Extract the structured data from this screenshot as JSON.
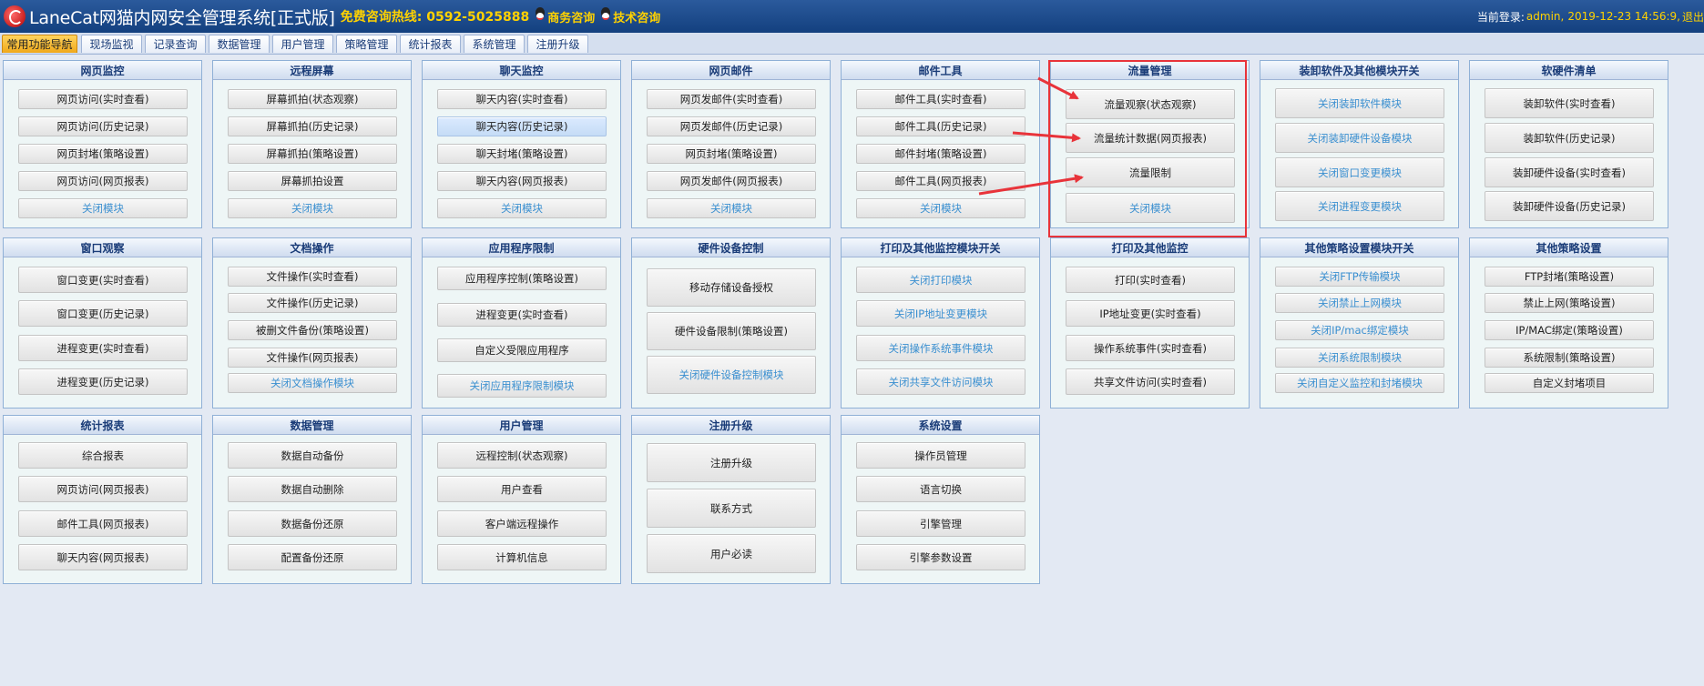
{
  "header": {
    "title": "LaneCat网猫内网安全管理系统[正式版]",
    "hotline": "免费咨询热线: 0592-5025888",
    "business_consult": "商务咨询",
    "tech_consult": "技术咨询",
    "login_label": "当前登录:",
    "login_user": "admin,",
    "login_time": "2019-12-23 14:56:9,",
    "logout": "退出"
  },
  "tabs": [
    {
      "label": "常用功能导航",
      "active": true
    },
    {
      "label": "现场监视"
    },
    {
      "label": "记录查询"
    },
    {
      "label": "数据管理"
    },
    {
      "label": "用户管理"
    },
    {
      "label": "策略管理"
    },
    {
      "label": "统计报表"
    },
    {
      "label": "系统管理"
    },
    {
      "label": "注册升级"
    }
  ],
  "panels": [
    {
      "title": "网页监控",
      "items": [
        "网页访问(实时查看)",
        "网页访问(历史记录)",
        "网页封堵(策略设置)",
        "网页访问(网页报表)",
        "关闭模块"
      ]
    },
    {
      "title": "远程屏幕",
      "items": [
        "屏幕抓拍(状态观察)",
        "屏幕抓拍(历史记录)",
        "屏幕抓拍(策略设置)",
        "屏幕抓拍设置",
        "关闭模块"
      ]
    },
    {
      "title": "聊天监控",
      "items": [
        "聊天内容(实时查看)",
        "聊天内容(历史记录)",
        "聊天封堵(策略设置)",
        "聊天内容(网页报表)",
        "关闭模块"
      ]
    },
    {
      "title": "网页邮件",
      "items": [
        "网页发邮件(实时查看)",
        "网页发邮件(历史记录)",
        "网页封堵(策略设置)",
        "网页发邮件(网页报表)",
        "关闭模块"
      ]
    },
    {
      "title": "邮件工具",
      "items": [
        "邮件工具(实时查看)",
        "邮件工具(历史记录)",
        "邮件封堵(策略设置)",
        "邮件工具(网页报表)",
        "关闭模块"
      ]
    },
    {
      "title": "流量管理",
      "items": [
        "流量观察(状态观察)",
        "流量统计数据(网页报表)",
        "流量限制",
        "关闭模块"
      ]
    },
    {
      "title": "装卸软件及其他模块开关",
      "items": [
        "关闭装卸软件模块",
        "关闭装卸硬件设备模块",
        "关闭窗口变更模块",
        "关闭进程变更模块"
      ]
    },
    {
      "title": "软硬件清单",
      "items": [
        "装卸软件(实时查看)",
        "装卸软件(历史记录)",
        "装卸硬件设备(实时查看)",
        "装卸硬件设备(历史记录)"
      ]
    },
    {
      "title": "窗口观察",
      "items": [
        "窗口变更(实时查看)",
        "窗口变更(历史记录)",
        "进程变更(实时查看)",
        "进程变更(历史记录)"
      ]
    },
    {
      "title": "文档操作",
      "items": [
        "文件操作(实时查看)",
        "文件操作(历史记录)",
        "被删文件备份(策略设置)",
        "文件操作(网页报表)",
        "关闭文档操作模块"
      ]
    },
    {
      "title": "应用程序限制",
      "items": [
        "应用程序控制(策略设置)",
        "进程变更(实时查看)",
        "自定义受限应用程序",
        "关闭应用程序限制模块"
      ]
    },
    {
      "title": "硬件设备控制",
      "items": [
        "移动存储设备授权",
        "硬件设备限制(策略设置)",
        "关闭硬件设备控制模块"
      ]
    },
    {
      "title": "打印及其他监控模块开关",
      "items": [
        "关闭打印模块",
        "关闭IP地址变更模块",
        "关闭操作系统事件模块",
        "关闭共享文件访问模块"
      ]
    },
    {
      "title": "打印及其他监控",
      "items": [
        "打印(实时查看)",
        "IP地址变更(实时查看)",
        "操作系统事件(实时查看)",
        "共享文件访问(实时查看)"
      ]
    },
    {
      "title": "其他策略设置模块开关",
      "items": [
        "关闭FTP传输模块",
        "关闭禁止上网模块",
        "关闭IP/mac绑定模块",
        "关闭系统限制模块",
        "关闭自定义监控和封堵模块"
      ]
    },
    {
      "title": "其他策略设置",
      "items": [
        "FTP封堵(策略设置)",
        "禁止上网(策略设置)",
        "IP/MAC绑定(策略设置)",
        "系统限制(策略设置)",
        "自定义封堵项目"
      ]
    },
    {
      "title": "统计报表",
      "items": [
        "综合报表",
        "网页访问(网页报表)",
        "邮件工具(网页报表)",
        "聊天内容(网页报表)"
      ]
    },
    {
      "title": "数据管理",
      "items": [
        "数据自动备份",
        "数据自动删除",
        "数据备份还原",
        "配置备份还原"
      ]
    },
    {
      "title": "用户管理",
      "items": [
        "远程控制(状态观察)",
        "用户查看",
        "客户端远程操作",
        "计算机信息"
      ]
    },
    {
      "title": "注册升级",
      "items": [
        "注册升级",
        "联系方式",
        "用户必读"
      ]
    },
    {
      "title": "系统设置",
      "items": [
        "操作员管理",
        "语言切换",
        "引擎管理",
        "引擎参数设置"
      ]
    }
  ]
}
